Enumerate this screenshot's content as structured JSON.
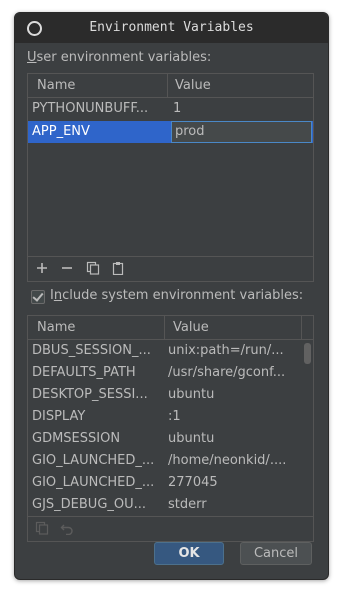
{
  "window": {
    "title": "Environment Variables"
  },
  "user_section": {
    "label_prefix": "",
    "label_underlined": "U",
    "label_rest": "ser environment variables:",
    "columns": [
      "Name",
      "Value"
    ],
    "rows": [
      {
        "name": "PYTHONUNBUFF...",
        "value": "1"
      },
      {
        "name": "APP_ENV",
        "value": "prod"
      }
    ]
  },
  "include_system": {
    "checked": true,
    "label_prefix": "I",
    "label_underlined": "n",
    "label_rest": "clude system environment variables:"
  },
  "system_section": {
    "columns": [
      "Name",
      "Value"
    ],
    "rows": [
      {
        "name": "DBUS_SESSION_...",
        "value": "unix:path=/run/..."
      },
      {
        "name": "DEFAULTS_PATH",
        "value": "/usr/share/gconf..."
      },
      {
        "name": "DESKTOP_SESSI...",
        "value": "ubuntu"
      },
      {
        "name": "DISPLAY",
        "value": ":1"
      },
      {
        "name": "GDMSESSION",
        "value": "ubuntu"
      },
      {
        "name": "GIO_LAUNCHED_...",
        "value": "/home/neonkid/...."
      },
      {
        "name": "GIO_LAUNCHED_...",
        "value": "277045"
      },
      {
        "name": "GJS_DEBUG_OU...",
        "value": "stderr"
      }
    ]
  },
  "icons": {
    "add": "plus-icon",
    "remove": "minus-icon",
    "copy": "copy-icon",
    "paste": "paste-icon",
    "undo": "undo-icon"
  },
  "buttons": {
    "ok": "OK",
    "cancel": "Cancel"
  }
}
